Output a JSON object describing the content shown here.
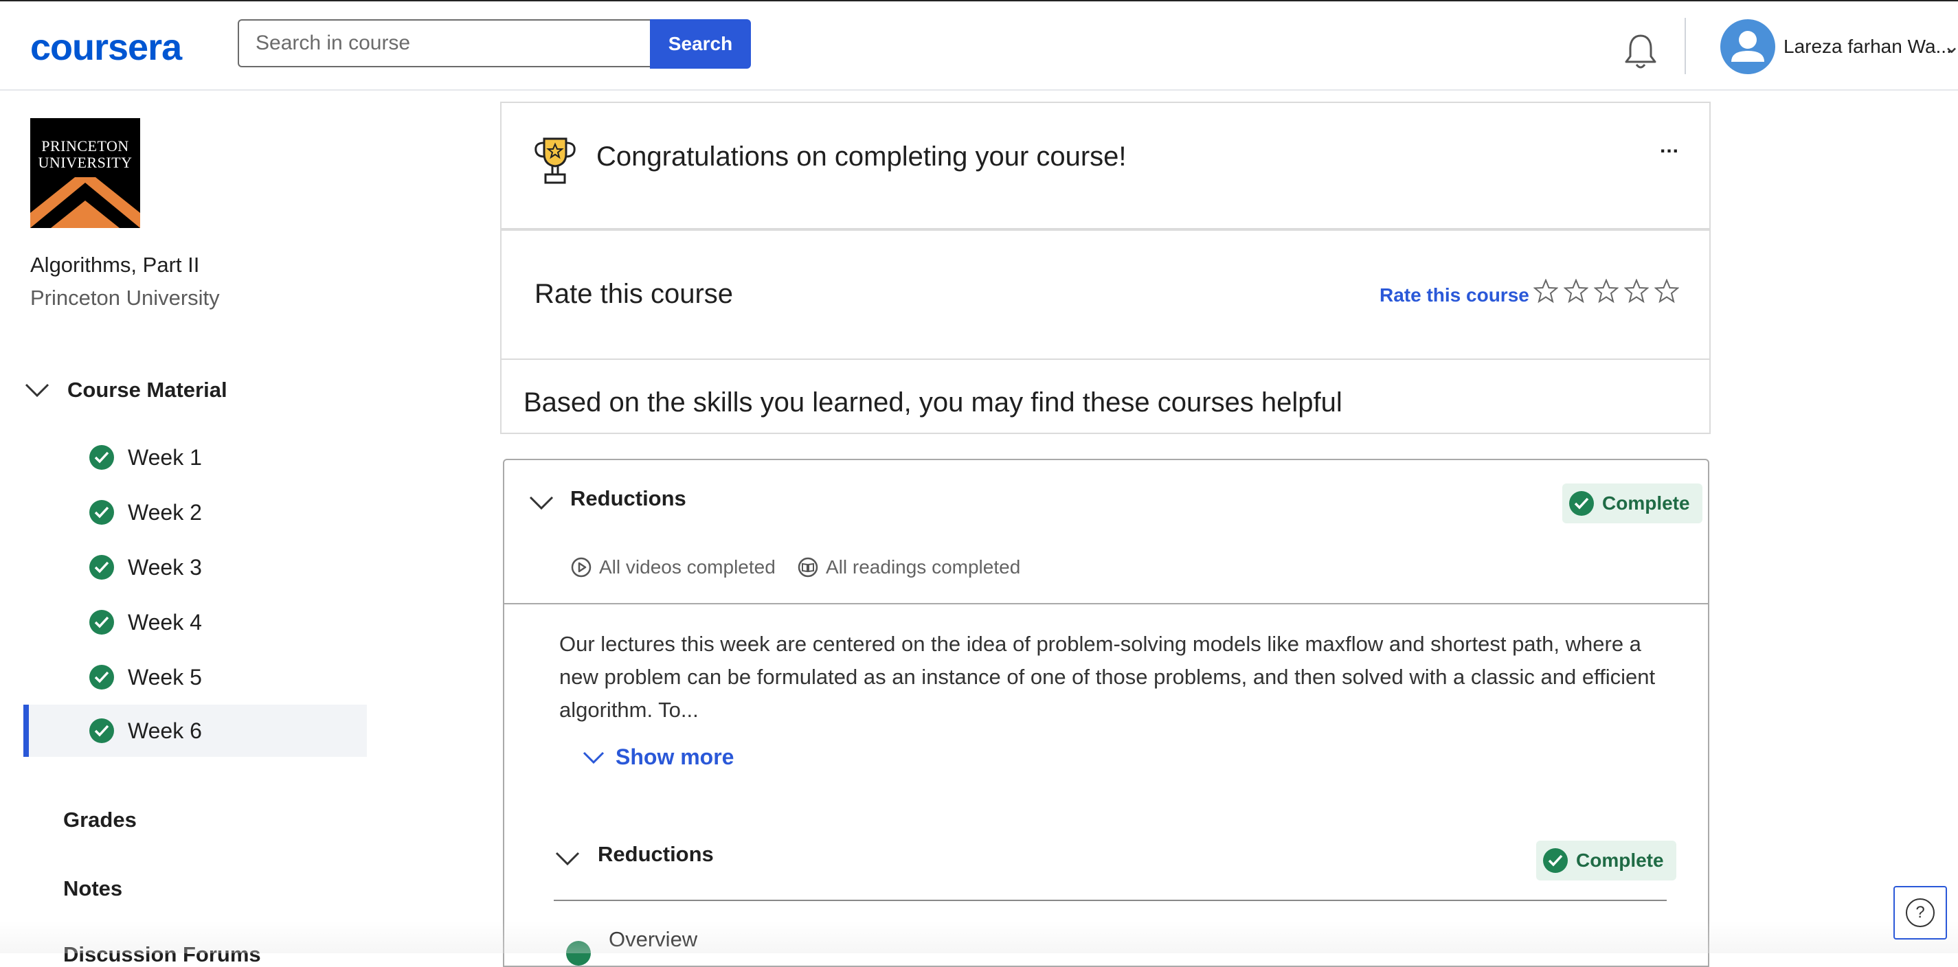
{
  "header": {
    "logo_text": "coursera",
    "search_placeholder": "Search in course",
    "search_button": "Search",
    "username": "Lareza farhan Wa..."
  },
  "sidebar": {
    "university_logo_line1": "PRINCETON",
    "university_logo_line2": "UNIVERSITY",
    "course_name": "Algorithms, Part II",
    "course_org": "Princeton University",
    "course_material_label": "Course Material",
    "weeks": [
      {
        "label": "Week 1",
        "completed": true
      },
      {
        "label": "Week 2",
        "completed": true
      },
      {
        "label": "Week 3",
        "completed": true
      },
      {
        "label": "Week 4",
        "completed": true
      },
      {
        "label": "Week 5",
        "completed": true
      },
      {
        "label": "Week 6",
        "completed": true,
        "active": true
      }
    ],
    "links": [
      "Grades",
      "Notes",
      "Discussion Forums"
    ]
  },
  "main": {
    "congrats_title": "Congratulations on completing your course!",
    "more_label": "...",
    "rate_title": "Rate this course",
    "rate_link": "Rate this course",
    "rating_stars_filled": 0,
    "rating_stars_total": 5,
    "helpful_title": "Based on the skills you learned, you may find these courses helpful",
    "module": {
      "title": "Reductions",
      "status": "Complete",
      "videos_status": "All videos completed",
      "readings_status": "All readings completed",
      "description": "Our lectures this week are centered on the idea of problem-solving models like maxflow and shortest path, where a new problem can be formulated as an instance of one of those problems, and then solved with a classic and efficient algorithm. To...",
      "show_more": "Show more",
      "lessons": [
        {
          "title": "Reductions",
          "status": "Complete",
          "items": [
            {
              "label": "Overview"
            }
          ]
        }
      ]
    }
  },
  "help_label": "?",
  "colors": {
    "brand": "#0056d2",
    "accent": "#2a58d8",
    "success": "#1f8354",
    "badge_bg": "#e6f3ec"
  }
}
